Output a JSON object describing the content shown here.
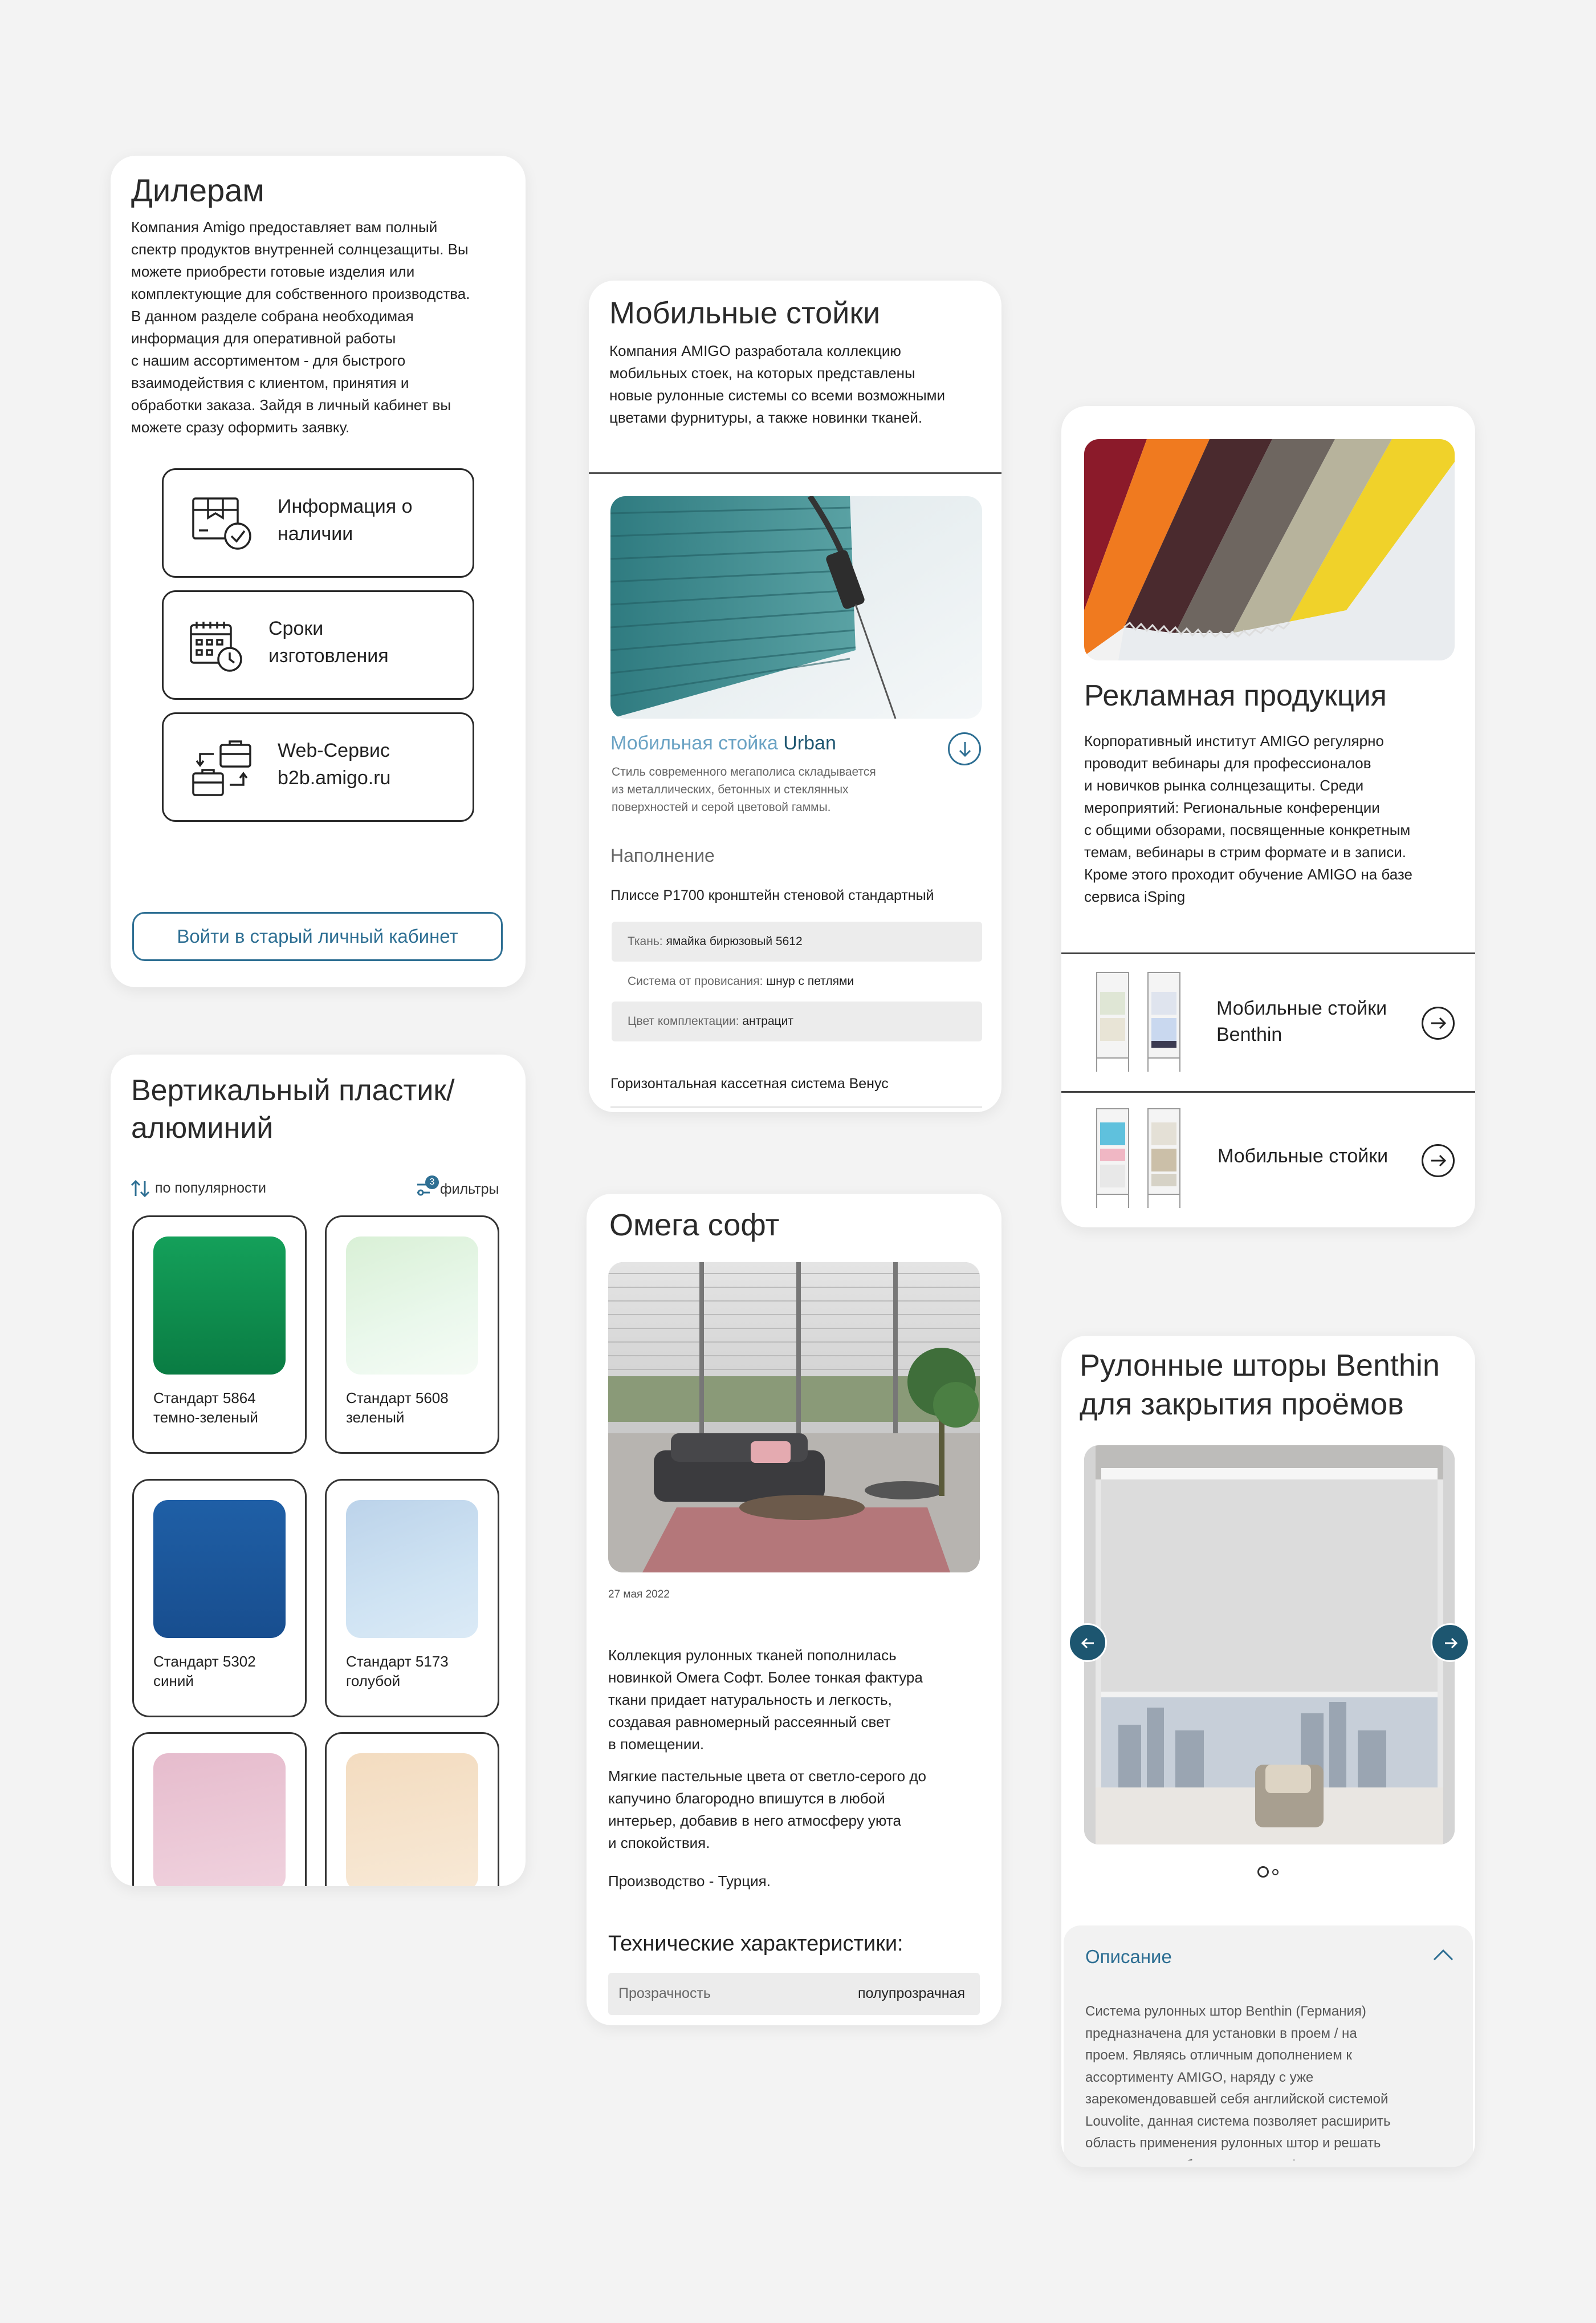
{
  "colors": {
    "background": "#f3f3f3",
    "card": "#ffffff",
    "accent": "#2e6f93",
    "accent_dark": "#1d5670",
    "text": "#1c1c1c",
    "muted": "#6b6b6b",
    "row_bg": "#ececec"
  },
  "dealers": {
    "title": "Дилерам",
    "paragraph": [
      "Компания Amigo предоставляет вам полный",
      "спектр продуктов внутренней солнцезащиты. Вы",
      "можете приобрести готовые изделия или",
      "комплектующие для собственного производства.",
      "В данном разделе собрана необходимая",
      "информация для оперативной работы",
      "с нашим ассортиментом - для быстрого",
      "взаимодействия с клиентом, принятия и",
      "обработки заказа. Зайдя в личный кабинет вы",
      "можете сразу оформить заявку."
    ],
    "links": [
      {
        "icon": "box-check-icon",
        "line1": "Информация о",
        "line2": "наличии"
      },
      {
        "icon": "calendar-clock-icon",
        "line1": "Сроки",
        "line2": "изготовления"
      },
      {
        "icon": "briefcase-exchange-icon",
        "line1": "Web-Сервис",
        "line2": "b2b.amigo.ru"
      }
    ],
    "login_button": "Войти в старый личный кабинет"
  },
  "vertical": {
    "title_line1": "Вертикальный пластик/",
    "title_line2": "алюминий",
    "sort_label": "по популярности",
    "filter_label": "фильтры",
    "filter_count": "3",
    "items": [
      {
        "line1": "Стандарт 5864",
        "line2": "темно-зеленый",
        "color": "#0d8a4d"
      },
      {
        "line1": "Стандарт 5608",
        "line2": "зеленый",
        "color": "#dff3df"
      },
      {
        "line1": "Стандарт 5302",
        "line2": "синий",
        "color": "#1f5fa6"
      },
      {
        "line1": "Стандарт 5173",
        "line2": "голубой",
        "color": "#c5dcef"
      },
      {
        "line1": "",
        "line2": "",
        "color": "#ecc6d6"
      },
      {
        "line1": "",
        "line2": "",
        "color": "#f6e2c6"
      }
    ]
  },
  "mobile": {
    "title": "Мобильные стойки",
    "paragraph": [
      "Компания AMIGO разработала коллекцию",
      "мобильных стоек, на которых представлены",
      "новые рулонные системы со всеми возможными",
      "цветами фурнитуры, а также новинки тканей."
    ],
    "product_prefix": "Мобильная стойка",
    "product_name": "Urban",
    "product_desc": [
      "Стиль современного мегаполиса складывается",
      "из металлических, бетонных и стеклянных",
      "поверхностей и серой цветовой гаммы."
    ],
    "fill_heading": "Наполнение",
    "item1_title": "Плиссе Р1700 кронштейн стеновой стандартный",
    "rows": [
      {
        "label": "Ткань:",
        "value": "ямайка бирюзовый 5612"
      },
      {
        "label": "Система от провисания:",
        "value": "шнур с петлями"
      },
      {
        "label": "Цвет комплектации:",
        "value": "антрацит"
      }
    ],
    "item2_title": "Горизонтальная кассетная система Венус"
  },
  "omega": {
    "title": "Омега софт",
    "date": "27 мая 2022",
    "paragraph1": [
      "Коллекция рулонных тканей пополнилась",
      "новинкой Омега Софт. Более тонкая фактура",
      "ткани придает натуральность и легкость,",
      "создавая равномерный рассеянный свет",
      "в помещении."
    ],
    "paragraph2": [
      "Мягкие пастельные цвета от светло-серого до",
      "капучино благородно впишутся в любой",
      "интерьер, добавив в него атмосферу уюта",
      "и спокойствия."
    ],
    "origin": "Производство - Турция.",
    "spec_heading": "Технические характеристики:",
    "spec_label": "Прозрачность",
    "spec_value": "полупрозрачная"
  },
  "promo": {
    "title": "Рекламная продукция",
    "paragraph": [
      "Корпоративный институт AMIGO регулярно",
      "проводит вебинары для профессионалов",
      "и новичков рынка солнцезащиты. Среди",
      "мероприятий: Региональные конференции",
      "с общими обзорами, посвященные конкретным",
      "темам, вебинары в стрим формате и в записи.",
      "Кроме этого проходит обучение AMIGO на базе",
      "сервиса iSping"
    ],
    "links": [
      {
        "line1": "Мобильные стойки",
        "line2": "Benthin"
      },
      {
        "line1": "Мобильные стойки",
        "line2": ""
      }
    ]
  },
  "benthin": {
    "title_line1": "Рулонные шторы Benthin",
    "title_line2": "для закрытия проёмов",
    "desc_heading": "Описание",
    "desc": [
      "Система рулонных штор Benthin (Германия)",
      "предназначена для установки в проем / на",
      "проем. Являясь отличным дополнением к",
      "ассортименту AMIGO, наряду с уже",
      "зарекомендовавшей себя английской системой",
      "Louvolite, данная система позволяет расширить",
      "область применения рулонных штор и решать",
      "практически любые задачи по оформлению"
    ]
  }
}
